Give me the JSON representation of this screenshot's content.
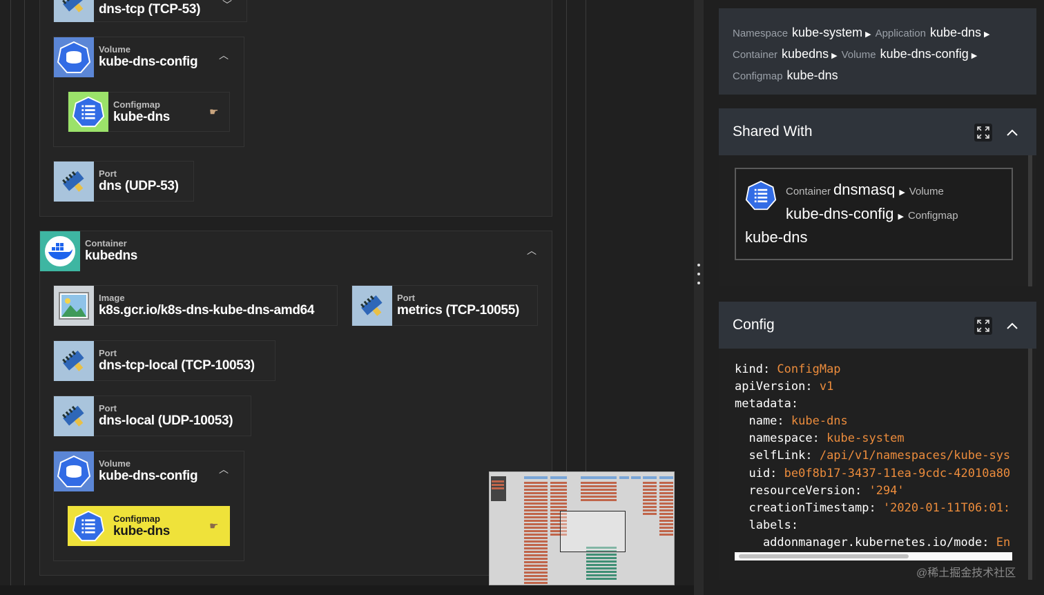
{
  "graph": {
    "top_port": {
      "name": "dns-tcp (TCP-53)"
    },
    "volume1": {
      "type": "Volume",
      "name": "kube-dns-config"
    },
    "configmap1": {
      "type": "Configmap",
      "name": "kube-dns"
    },
    "port_dns": {
      "type": "Port",
      "name": "dns (UDP-53)"
    },
    "container": {
      "type": "Container",
      "name": "kubedns"
    },
    "image": {
      "type": "Image",
      "name": "k8s.gcr.io/k8s-dns-kube-dns-amd64"
    },
    "port_metrics": {
      "type": "Port",
      "name": "metrics (TCP-10055)"
    },
    "port_dns_tcp_local": {
      "type": "Port",
      "name": "dns-tcp-local (TCP-10053)"
    },
    "port_dns_local": {
      "type": "Port",
      "name": "dns-local (UDP-10053)"
    },
    "volume2": {
      "type": "Volume",
      "name": "kube-dns-config"
    },
    "configmap2": {
      "type": "Configmap",
      "name": "kube-dns"
    }
  },
  "breadcrumb": [
    {
      "key": "Namespace",
      "value": "kube-system"
    },
    {
      "key": "Application",
      "value": "kube-dns"
    },
    {
      "key": "Container",
      "value": "kubedns"
    },
    {
      "key": "Volume",
      "value": "kube-dns-config"
    },
    {
      "key": "Configmap",
      "value": "kube-dns"
    }
  ],
  "shared_with": {
    "title": "Shared With",
    "container_key": "Container",
    "container_value": "dnsmasq",
    "volume_key": "Volume",
    "volume_value": "kube-dns-config",
    "configmap_key": "Configmap",
    "configmap_value": "kube-dns"
  },
  "config": {
    "title": "Config",
    "lines": [
      {
        "indent": "",
        "key": "kind",
        "value": "ConfigMap"
      },
      {
        "indent": "",
        "key": "apiVersion",
        "value": "v1"
      },
      {
        "indent": "",
        "key": "metadata",
        "value": ""
      },
      {
        "indent": "  ",
        "key": "name",
        "value": "kube-dns"
      },
      {
        "indent": "  ",
        "key": "namespace",
        "value": "kube-system"
      },
      {
        "indent": "  ",
        "key": "selfLink",
        "value": "/api/v1/namespaces/kube-sys"
      },
      {
        "indent": "  ",
        "key": "uid",
        "value": "be0f8b17-3437-11ea-9cdc-42010a80"
      },
      {
        "indent": "  ",
        "key": "resourceVersion",
        "value": "'294'"
      },
      {
        "indent": "  ",
        "key": "creationTimestamp",
        "value": "'2020-01-11T06:01:"
      },
      {
        "indent": "  ",
        "key": "labels",
        "value": ""
      },
      {
        "indent": "    ",
        "key": "addonmanager.kubernetes.io/mode",
        "value": "En"
      }
    ]
  },
  "watermark": "@稀土掘金技术社区",
  "colors": {
    "accent_orange": "#ec8c3c",
    "highlight_yellow": "#efe23a",
    "k8s_blue": "#326ce5"
  }
}
